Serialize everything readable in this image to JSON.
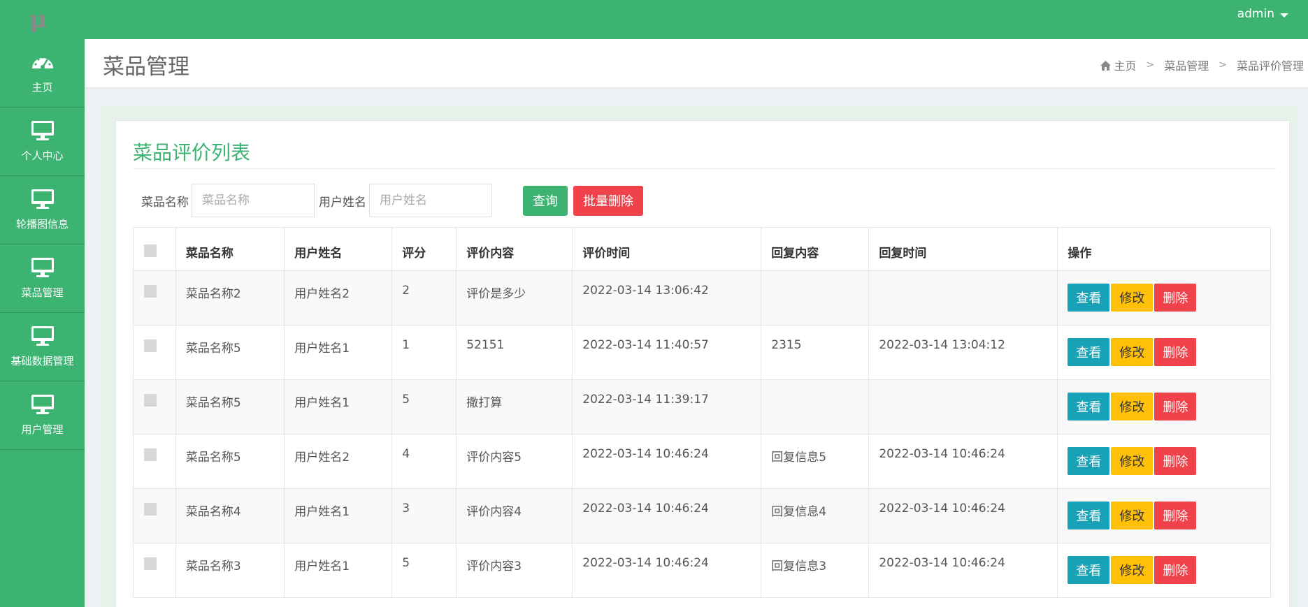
{
  "app": {
    "logo_text": "μ",
    "user": "admin"
  },
  "sidebar": {
    "items": [
      {
        "label": "主页",
        "icon": "dashboard-icon"
      },
      {
        "label": "个人中心",
        "icon": "monitor-icon"
      },
      {
        "label": "轮播图信息",
        "icon": "monitor-icon"
      },
      {
        "label": "菜品管理",
        "icon": "monitor-icon"
      },
      {
        "label": "基础数据管理",
        "icon": "monitor-icon"
      },
      {
        "label": "用户管理",
        "icon": "monitor-icon"
      }
    ]
  },
  "header": {
    "title": "菜品管理",
    "breadcrumb": [
      "主页",
      "菜品管理",
      "菜品评价管理"
    ]
  },
  "card": {
    "title": "菜品评价列表",
    "filters": {
      "dish_label": "菜品名称",
      "dish_placeholder": "菜品名称",
      "user_label": "用户姓名",
      "user_placeholder": "用户姓名",
      "query_button": "查询",
      "batch_delete_button": "批量删除"
    }
  },
  "table": {
    "columns": [
      "菜品名称",
      "用户姓名",
      "评分",
      "评价内容",
      "评价时间",
      "回复内容",
      "回复时间",
      "操作"
    ],
    "actions": {
      "view": "查看",
      "edit": "修改",
      "delete": "删除"
    },
    "rows": [
      {
        "dish": "菜品名称2",
        "user": "用户姓名2",
        "score": "2",
        "content": "评价是多少",
        "time": "2022-03-14 13:06:42",
        "reply": "",
        "reply_time": ""
      },
      {
        "dish": "菜品名称5",
        "user": "用户姓名1",
        "score": "1",
        "content": "52151",
        "time": "2022-03-14 11:40:57",
        "reply": "2315",
        "reply_time": "2022-03-14 13:04:12"
      },
      {
        "dish": "菜品名称5",
        "user": "用户姓名1",
        "score": "5",
        "content": "撒打算",
        "time": "2022-03-14 11:39:17",
        "reply": "",
        "reply_time": ""
      },
      {
        "dish": "菜品名称5",
        "user": "用户姓名2",
        "score": "4",
        "content": "评价内容5",
        "time": "2022-03-14 10:46:24",
        "reply": "回复信息5",
        "reply_time": "2022-03-14 10:46:24"
      },
      {
        "dish": "菜品名称4",
        "user": "用户姓名1",
        "score": "3",
        "content": "评价内容4",
        "time": "2022-03-14 10:46:24",
        "reply": "回复信息4",
        "reply_time": "2022-03-14 10:46:24"
      },
      {
        "dish": "菜品名称3",
        "user": "用户姓名1",
        "score": "5",
        "content": "评价内容3",
        "time": "2022-03-14 10:46:24",
        "reply": "回复信息3",
        "reply_time": "2022-03-14 10:46:24"
      }
    ]
  },
  "colors": {
    "brand": "#3cb371",
    "view": "#17a2b8",
    "edit": "#ffc107",
    "delete": "#f0424b"
  }
}
